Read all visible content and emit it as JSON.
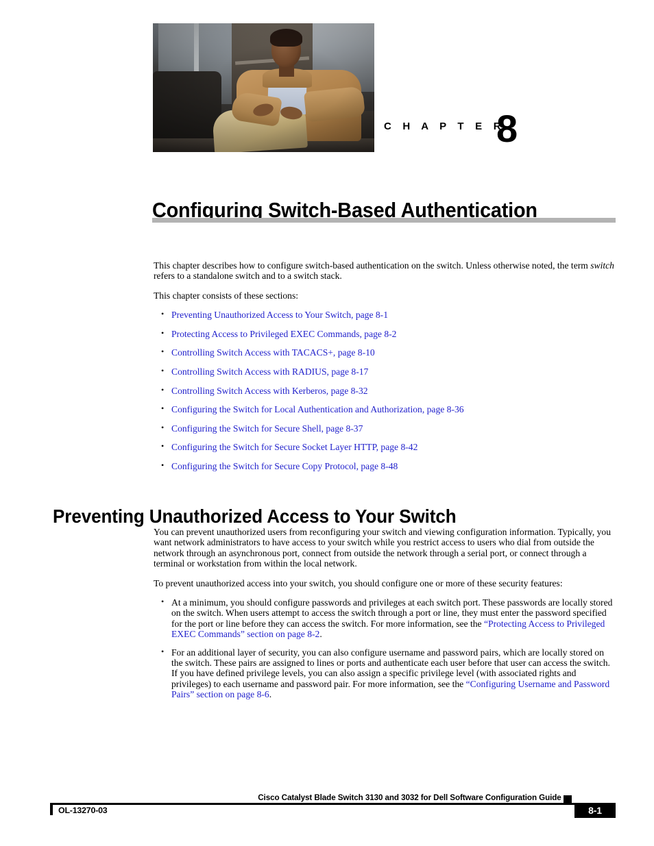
{
  "chapter": {
    "label": "C H A P T E R",
    "number": "8",
    "title": "Configuring Switch-Based Authentication",
    "photo_alt": "chapter-opener-photo"
  },
  "intro": {
    "paragraph_1_part_1": "This chapter describes how to configure switch-based authentication on the switch. Unless otherwise noted, the term ",
    "paragraph_1_italic": "switch",
    "paragraph_1_part_2": " refers to a standalone switch and to a switch stack.",
    "paragraph_2": "This chapter consists of these sections:"
  },
  "toc_links": [
    "Preventing Unauthorized Access to Your Switch, page 8-1",
    "Protecting Access to Privileged EXEC Commands, page 8-2",
    "Controlling Switch Access with TACACS+, page 8-10",
    "Controlling Switch Access with RADIUS, page 8-17",
    "Controlling Switch Access with Kerberos, page 8-32",
    "Configuring the Switch for Local Authentication and Authorization, page 8-36",
    "Configuring the Switch for Secure Shell, page 8-37",
    "Configuring the Switch for Secure Socket Layer HTTP, page 8-42",
    "Configuring the Switch for Secure Copy Protocol, page 8-48"
  ],
  "section": {
    "heading": "Preventing Unauthorized Access to Your Switch",
    "paragraph_1": "You can prevent unauthorized users from reconfiguring your switch and viewing configuration information. Typically, you want network administrators to have access to your switch while you restrict access to users who dial from outside the network through an asynchronous port, connect from outside the network through a serial port, or connect through a terminal or workstation from within the local network.",
    "paragraph_2": "To prevent unauthorized access into your switch, you should configure one or more of these security features:",
    "bullets": [
      {
        "text_before": "At a minimum, you should configure passwords and privileges at each switch port. These passwords are locally stored on the switch. When users attempt to access the switch through a port or line, they must enter the password specified for the port or line before they can access the switch. For more information, see the ",
        "link": "“Protecting Access to Privileged EXEC Commands” section on page 8-2",
        "text_after": "."
      },
      {
        "text_before": "For an additional layer of security, you can also configure username and password pairs, which are locally stored on the switch. These pairs are assigned to lines or ports and authenticate each user before that user can access the switch. If you have defined privilege levels, you can also assign a specific privilege level (with associated rights and privileges) to each username and password pair. For more information, see the ",
        "link": "“Configuring Username and Password Pairs” section on page 8-6",
        "text_after": "."
      }
    ]
  },
  "footer": {
    "guide_title": "Cisco Catalyst Blade Switch 3130 and 3032 for Dell Software Configuration Guide",
    "part_number": "OL-13270-03",
    "page_number": "8-1"
  },
  "colors": {
    "link_blue": "#2222cc",
    "rule_gray": "#b3b3b3",
    "footer_black": "#000000"
  }
}
